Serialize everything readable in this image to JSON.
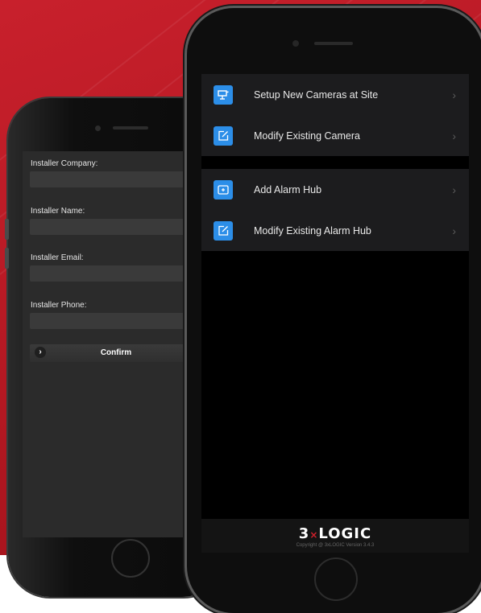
{
  "brand": {
    "red": "#c8202c",
    "accent_blue": "#2c8ee8"
  },
  "installer_form": {
    "fields": [
      {
        "label": "Installer Company:",
        "value": ""
      },
      {
        "label": "Installer Name:",
        "value": ""
      },
      {
        "label": "Installer Email:",
        "value": ""
      },
      {
        "label": "Installer Phone:",
        "value": ""
      }
    ],
    "confirm_label": "Confirm",
    "confirm_icon": "chevron-right-icon"
  },
  "main_menu": {
    "cameras_group": [
      {
        "label": "Setup New Cameras at Site",
        "icon": "camera-setup-icon"
      },
      {
        "label": "Modify Existing Camera",
        "icon": "edit-icon"
      }
    ],
    "alarm_group": [
      {
        "label": "Add Alarm Hub",
        "icon": "add-box-icon"
      },
      {
        "label": "Modify Existing Alarm Hub",
        "icon": "edit-icon"
      }
    ],
    "chevron": "›"
  },
  "footer": {
    "logo_left": "3",
    "logo_x": "×",
    "logo_right": "LOGIC",
    "copyright": "Copyright @ 3xLOGIC Version 3.4.3"
  }
}
